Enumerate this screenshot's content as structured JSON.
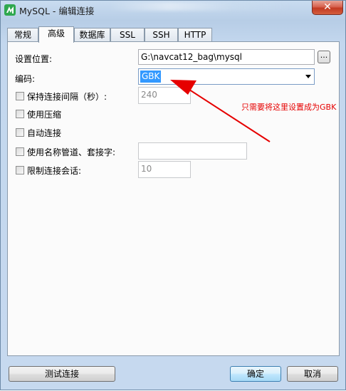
{
  "window": {
    "title": "MySQL - 编辑连接",
    "close_glyph": "✕"
  },
  "tabs": [
    {
      "label": "常规",
      "active": false
    },
    {
      "label": "高级",
      "active": true
    },
    {
      "label": "数据库",
      "active": false
    },
    {
      "label": "SSL",
      "active": false
    },
    {
      "label": "SSH",
      "active": false
    },
    {
      "label": "HTTP",
      "active": false
    }
  ],
  "form": {
    "location_label": "设置位置:",
    "location_value": "G:\\navcat12_bag\\mysql",
    "browse_label": "...",
    "encoding_label": "编码:",
    "encoding_value": "GBK",
    "keepalive_label": "保持连接间隔（秒）:",
    "keepalive_value": "240",
    "keepalive_checked": false,
    "compression_label": "使用压缩",
    "compression_checked": false,
    "autoconnect_label": "自动连接",
    "autoconnect_checked": false,
    "namedpipe_label": "使用名称管道、套接字:",
    "namedpipe_value": "",
    "namedpipe_checked": false,
    "limitsessions_label": "限制连接会话:",
    "limitsessions_value": "10",
    "limitsessions_checked": false
  },
  "annotation": {
    "text": "只需要将这里设置成为GBK",
    "color": "#e60000"
  },
  "buttons": {
    "test_label": "测试连接",
    "ok_label": "确定",
    "cancel_label": "取消"
  },
  "colors": {
    "selection": "#3399ff",
    "annotation": "#e60000"
  }
}
